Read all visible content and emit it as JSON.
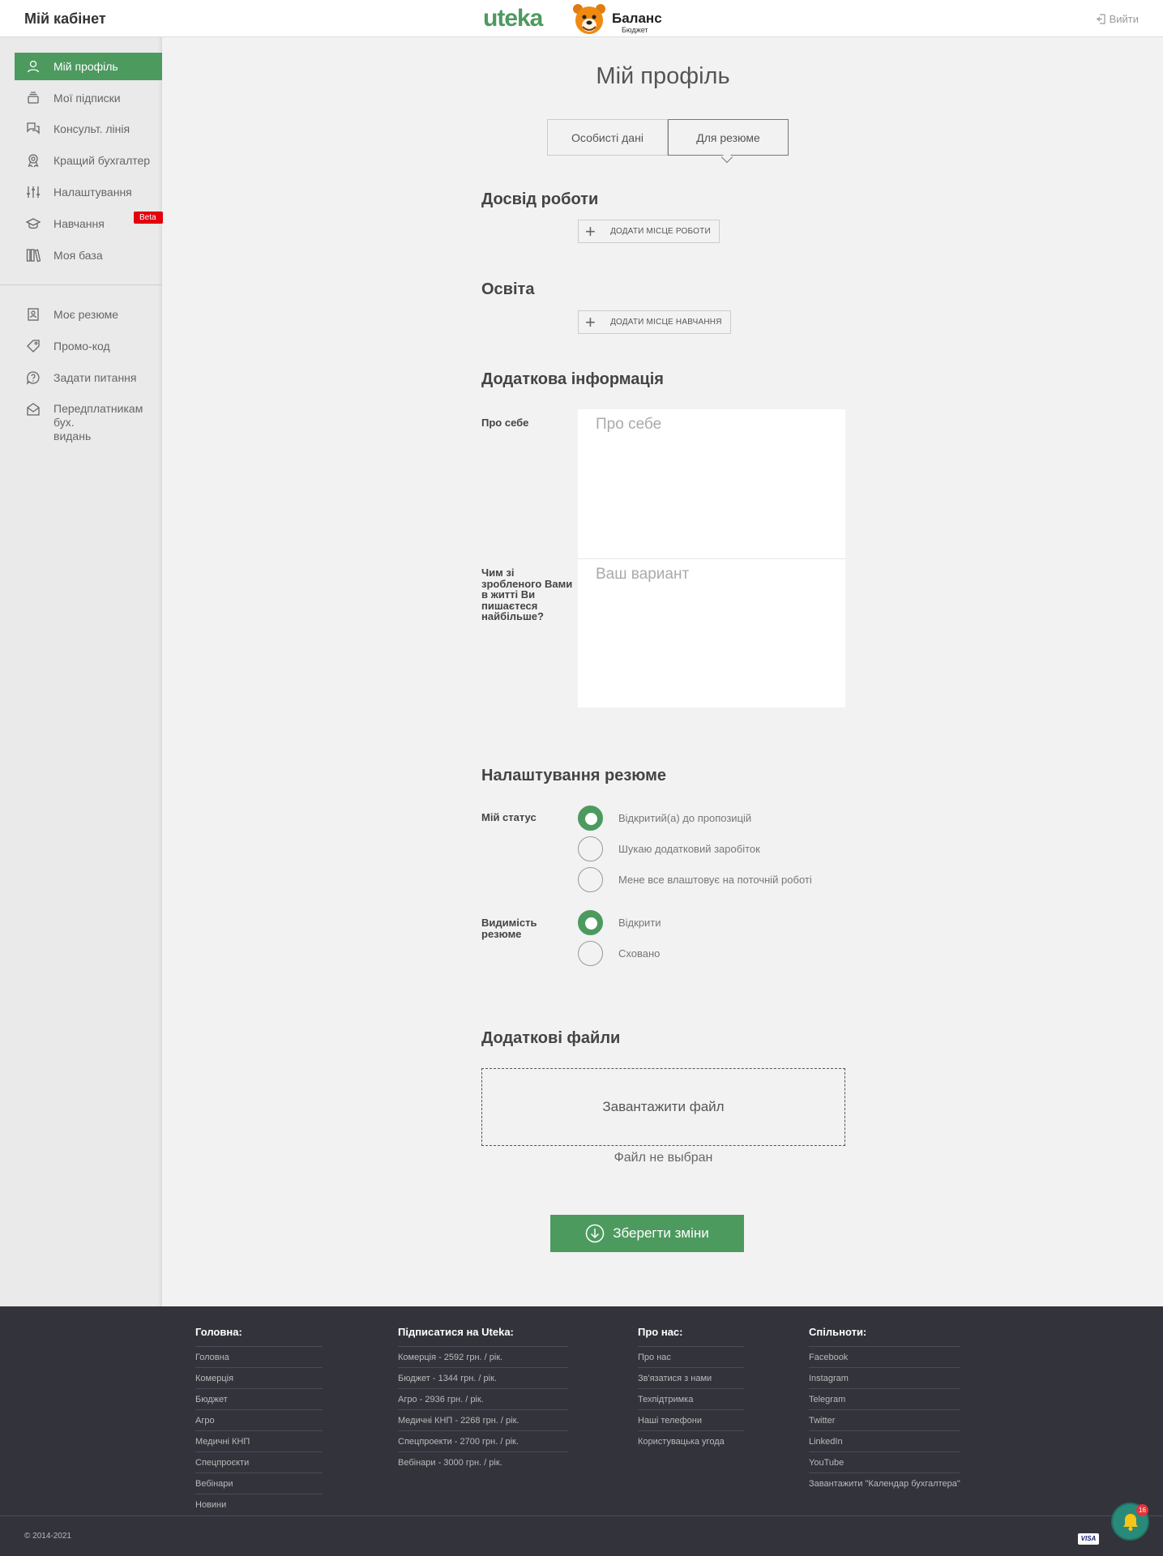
{
  "header": {
    "title": "Мій кабінет",
    "logo_uteka": "uteka",
    "logo_balans": "Баланс",
    "logo_balans_sub": "Бюджет",
    "logout": "Вийти"
  },
  "sidebar": {
    "items": [
      {
        "label": "Мій профіль",
        "icon": "user-icon",
        "active": true
      },
      {
        "label": "Мої підписки",
        "icon": "subscriptions-icon"
      },
      {
        "label": "Консульт. лінія",
        "icon": "chat-icon"
      },
      {
        "label": "Кращий бухгалтер",
        "icon": "award-icon"
      },
      {
        "label": "Налаштування",
        "icon": "sliders-icon"
      },
      {
        "label": "Навчання",
        "icon": "graduation-cap-icon"
      },
      {
        "label": "Моя база",
        "icon": "books-icon"
      }
    ],
    "beta_badge": "Beta",
    "items2": [
      {
        "label": "Моє резюме",
        "icon": "resume-icon"
      },
      {
        "label": "Промо-код",
        "icon": "tag-icon"
      },
      {
        "label": "Задати питання",
        "icon": "question-icon"
      },
      {
        "label": "Передплатникам бух.",
        "label2": "видань",
        "icon": "mail-icon"
      }
    ]
  },
  "main": {
    "title": "Мій профіль",
    "tabs": [
      {
        "label": "Особисті дані"
      },
      {
        "label": "Для резюме",
        "active": true
      }
    ],
    "experience": {
      "heading": "Досвід роботи",
      "add_label": "ДОДАТИ МІСЦЕ РОБОТИ"
    },
    "education": {
      "heading": "Освіта",
      "add_label": "ДОДАТИ МІСЦЕ НАВЧАННЯ"
    },
    "extra": {
      "heading": "Додаткова інформація",
      "about_label": "Про себе",
      "about_placeholder": "Про себе",
      "proud_label": "Чим зі зробленого Вами в житті Ви пишаєтеся найбільше?",
      "proud_placeholder": "Ваш вариант"
    },
    "resume_settings": {
      "heading": "Налаштування резюме",
      "status_label": "Мій статус",
      "status_options": [
        {
          "label": "Відкритий(а) до пропозицій",
          "selected": true
        },
        {
          "label": "Шукаю додатковий заробіток"
        },
        {
          "label": "Мене все влаштовує на поточній роботі"
        }
      ],
      "visibility_label": "Видимість резюме",
      "visibility_options": [
        {
          "label": "Відкрити",
          "selected": true
        },
        {
          "label": "Сховано"
        }
      ]
    },
    "files": {
      "heading": "Додаткові файли",
      "upload_label": "Завантажити файл",
      "no_file": "Файл не выбран"
    },
    "save_label": "Зберегти зміни"
  },
  "footer": {
    "columns": [
      {
        "heading": "Головна:",
        "links": [
          "Головна",
          "Комерція",
          "Бюджет",
          "Агро",
          "Медичні КНП",
          "Спецпроєкти",
          "Вебінари",
          "Новини"
        ]
      },
      {
        "heading": "Підписатися на Uteka:",
        "links": [
          "Комерція - 2592 грн. / рік.",
          "Бюджет - 1344 грн. / рік.",
          "Агро - 2936 грн. / рік.",
          "Медичні КНП - 2268 грн. / рік.",
          "Спецпроекти - 2700 грн. / рік.",
          "Вебінари - 3000 грн. / рік."
        ]
      },
      {
        "heading": "Про нас:",
        "links": [
          "Про нас",
          "Зв'язатися з нами",
          "Техпідтримка",
          "Наші телефони",
          "Користувацька угода"
        ]
      },
      {
        "heading": "Спільноти:",
        "links": [
          "Facebook",
          "Instagram",
          "Telegram",
          "Twitter",
          "LinkedIn",
          "YouTube",
          "Завантажити \"Календар бухгалтера\""
        ]
      }
    ],
    "copyright": "© 2014-2021",
    "visa": "VISA",
    "notifications_count": "16"
  },
  "colors": {
    "accent": "#4d9a5f",
    "beta": "#e3000f",
    "footer_bg": "#32333b"
  }
}
